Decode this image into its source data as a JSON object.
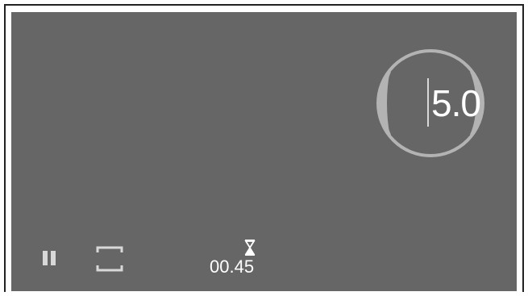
{
  "panel": {
    "dial": {
      "value": "5.0",
      "icon": "dial-knob-icon"
    },
    "controls": {
      "pause_icon": "pause-icon",
      "frame_icon": "frame-corners-icon"
    },
    "timer": {
      "icon": "hourglass-icon",
      "value": "00.45"
    }
  },
  "colors": {
    "screen_bg": "#666666",
    "dial_ring": "#b3b3b3",
    "text": "#ffffff"
  }
}
